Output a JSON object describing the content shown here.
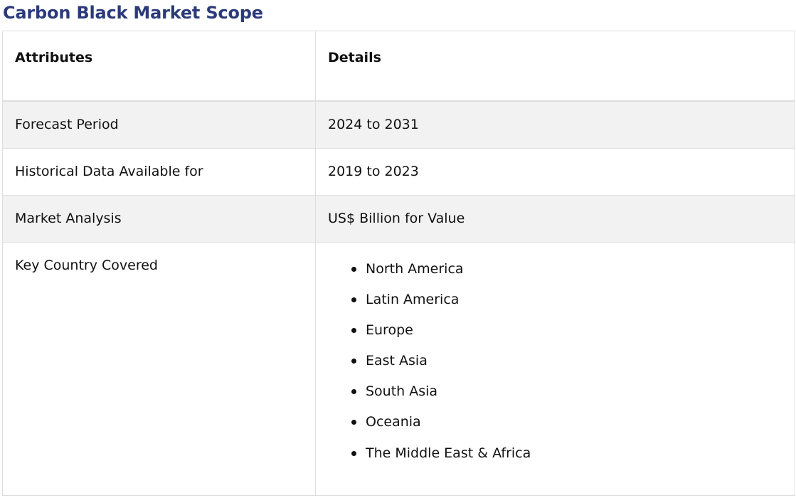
{
  "title": "Carbon Black Market Scope",
  "table": {
    "headers": [
      "Attributes",
      "Details"
    ],
    "rows": [
      {
        "attribute": "Forecast Period",
        "detail": "2024 to 2031"
      },
      {
        "attribute": "Historical Data Available for",
        "detail": "2019 to 2023"
      },
      {
        "attribute": "Market Analysis",
        "detail": "US$ Billion for Value"
      }
    ],
    "regions_row": {
      "attribute": "Key Country Covered",
      "items": [
        "North America",
        "Latin America",
        "Europe",
        "East Asia",
        "South Asia",
        "Oceania",
        "The Middle East & Africa"
      ]
    }
  },
  "colors": {
    "title": "#2b3a7a",
    "shaded_row": "#f2f2f2",
    "border": "#dedede"
  }
}
